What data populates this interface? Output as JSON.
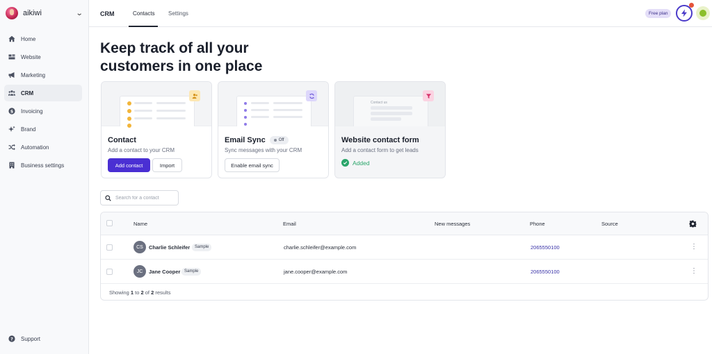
{
  "sidebar": {
    "workspace": "aikiwi",
    "items": [
      {
        "label": "Home",
        "icon": "home-icon"
      },
      {
        "label": "Website",
        "icon": "website-icon"
      },
      {
        "label": "Marketing",
        "icon": "megaphone-icon"
      },
      {
        "label": "CRM",
        "icon": "users-icon"
      },
      {
        "label": "Invoicing",
        "icon": "dollar-icon"
      },
      {
        "label": "Brand",
        "icon": "sparkle-icon"
      },
      {
        "label": "Automation",
        "icon": "shuffle-icon"
      },
      {
        "label": "Business settings",
        "icon": "building-icon"
      }
    ],
    "active": "CRM",
    "support": "Support"
  },
  "topbar": {
    "title": "CRM",
    "tabs": [
      "Contacts",
      "Settings"
    ],
    "active_tab": "Contacts",
    "plan": "Free plan"
  },
  "hero": {
    "line1": "Keep track of all your",
    "line2": "customers in one place"
  },
  "cards": {
    "contact": {
      "title": "Contact",
      "subtitle": "Add a contact to your CRM",
      "primary": "Add contact",
      "secondary": "Import"
    },
    "email": {
      "title": "Email Sync",
      "status": "Off",
      "subtitle": "Sync messages with your CRM",
      "button": "Enable email sync"
    },
    "form": {
      "title": "Website contact form",
      "subtitle": "Add a contact form to get leads",
      "status": "Added",
      "art_label": "Contact us"
    }
  },
  "search": {
    "placeholder": "Search for a contact"
  },
  "table": {
    "columns": {
      "name": "Name",
      "email": "Email",
      "messages": "New messages",
      "phone": "Phone",
      "source": "Source"
    },
    "rows": [
      {
        "initials": "CS",
        "name": "Charlie Schleifer",
        "tag": "Sample",
        "email": "charlie.schleifer@example.com",
        "messages": "",
        "phone": "2065550100",
        "source": ""
      },
      {
        "initials": "JC",
        "name": "Jane Cooper",
        "tag": "Sample",
        "email": "jane.cooper@example.com",
        "messages": "",
        "phone": "2065550100",
        "source": ""
      }
    ],
    "footer": {
      "prefix": "Showing",
      "from": "1",
      "to_word": "to",
      "to": "2",
      "of_word": "of",
      "total": "2",
      "suffix": "results"
    }
  },
  "colors": {
    "accent": "#4a2fd3",
    "success": "#2aa56a",
    "phone_link": "#3a33a8"
  }
}
